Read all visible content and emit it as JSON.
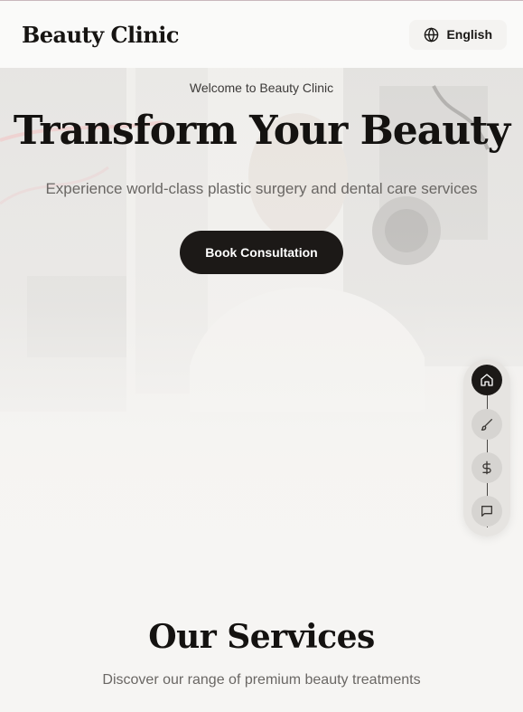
{
  "header": {
    "brand": "Beauty Clinic",
    "language": "English"
  },
  "hero": {
    "welcome": "Welcome to Beauty Clinic",
    "title": "Transform Your Beauty",
    "subtitle": "Experience world-class plastic surgery and dental care services",
    "cta_label": "Book Consultation"
  },
  "side_nav": {
    "items": [
      {
        "icon": "home-icon",
        "active": true
      },
      {
        "icon": "brush-icon",
        "active": false
      },
      {
        "icon": "dollar-icon",
        "active": false
      },
      {
        "icon": "message-icon",
        "active": false
      }
    ]
  },
  "services": {
    "title": "Our Services",
    "subtitle": "Discover our range of premium beauty treatments"
  },
  "colors": {
    "dark": "#1c1917",
    "background": "#f6f5f3",
    "muted_text": "#6a6764"
  }
}
